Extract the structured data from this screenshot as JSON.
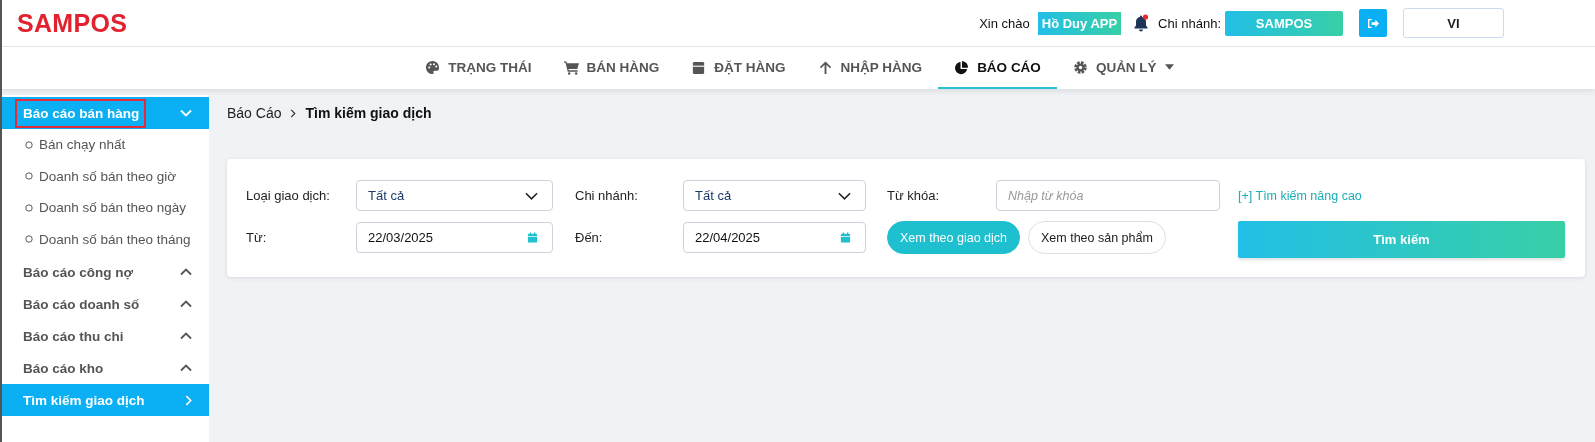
{
  "header": {
    "logo": "SAMPOS",
    "greeting": "Xin chào",
    "user": "Hồ Duy APP",
    "notification_dot": true,
    "branch_label": "Chi nhánh:",
    "branch": "SAMPOS",
    "language": "VI"
  },
  "nav": [
    {
      "label": "TRẠNG THÁI",
      "selected": false,
      "dropdown": false
    },
    {
      "label": "BÁN HÀNG",
      "selected": false,
      "dropdown": false
    },
    {
      "label": "ĐẶT HÀNG",
      "selected": false,
      "dropdown": false
    },
    {
      "label": "NHẬP HÀNG",
      "selected": false,
      "dropdown": false
    },
    {
      "label": "BÁO CÁO",
      "selected": true,
      "dropdown": false
    },
    {
      "label": "QUẢN LÝ",
      "selected": false,
      "dropdown": true
    }
  ],
  "sidebar": [
    {
      "kind": "group",
      "label": "Báo cáo bán hàng",
      "selected": true,
      "expanded": true,
      "highlighted": true,
      "children": [
        {
          "label": "Bán chạy nhất"
        },
        {
          "label": "Doanh số bán theo giờ"
        },
        {
          "label": "Doanh số bán theo ngày"
        },
        {
          "label": "Doanh số bán theo tháng"
        }
      ]
    },
    {
      "kind": "group",
      "label": "Báo cáo công nợ",
      "selected": false,
      "expanded": false,
      "highlighted": false
    },
    {
      "kind": "group",
      "label": "Báo cáo doanh số",
      "selected": false,
      "expanded": false,
      "highlighted": false
    },
    {
      "kind": "group",
      "label": "Báo cáo thu chi",
      "selected": false,
      "expanded": false,
      "highlighted": false
    },
    {
      "kind": "group",
      "label": "Báo cáo kho",
      "selected": false,
      "expanded": false,
      "highlighted": false
    },
    {
      "kind": "link",
      "label": "Tìm kiếm giao dịch",
      "selected": true,
      "expanded": false,
      "highlighted": false
    }
  ],
  "breadcrumb": [
    "Báo Cáo",
    "Tìm kiếm giao dịch"
  ],
  "search_form": {
    "fields": [
      {
        "kind": "select",
        "label": "Loại giao dịch:",
        "value": "Tất cả"
      },
      {
        "kind": "select",
        "label": "Chi nhánh:",
        "value": "Tất cả"
      },
      {
        "kind": "text",
        "label": "Từ khóa:",
        "placeholder": "Nhập từ khóa"
      },
      {
        "kind": "date",
        "label": "Từ:",
        "value": "22/03/2025"
      },
      {
        "kind": "date",
        "label": "Đến:",
        "value": "22/04/2025"
      }
    ],
    "advanced_link": "[+] Tìm kiếm nâng cao",
    "view_modes": [
      {
        "label": "Xem theo giao dịch",
        "selected": true
      },
      {
        "label": "Xem theo sản phẩm",
        "selected": false
      }
    ],
    "search_button": "Tìm kiếm"
  }
}
